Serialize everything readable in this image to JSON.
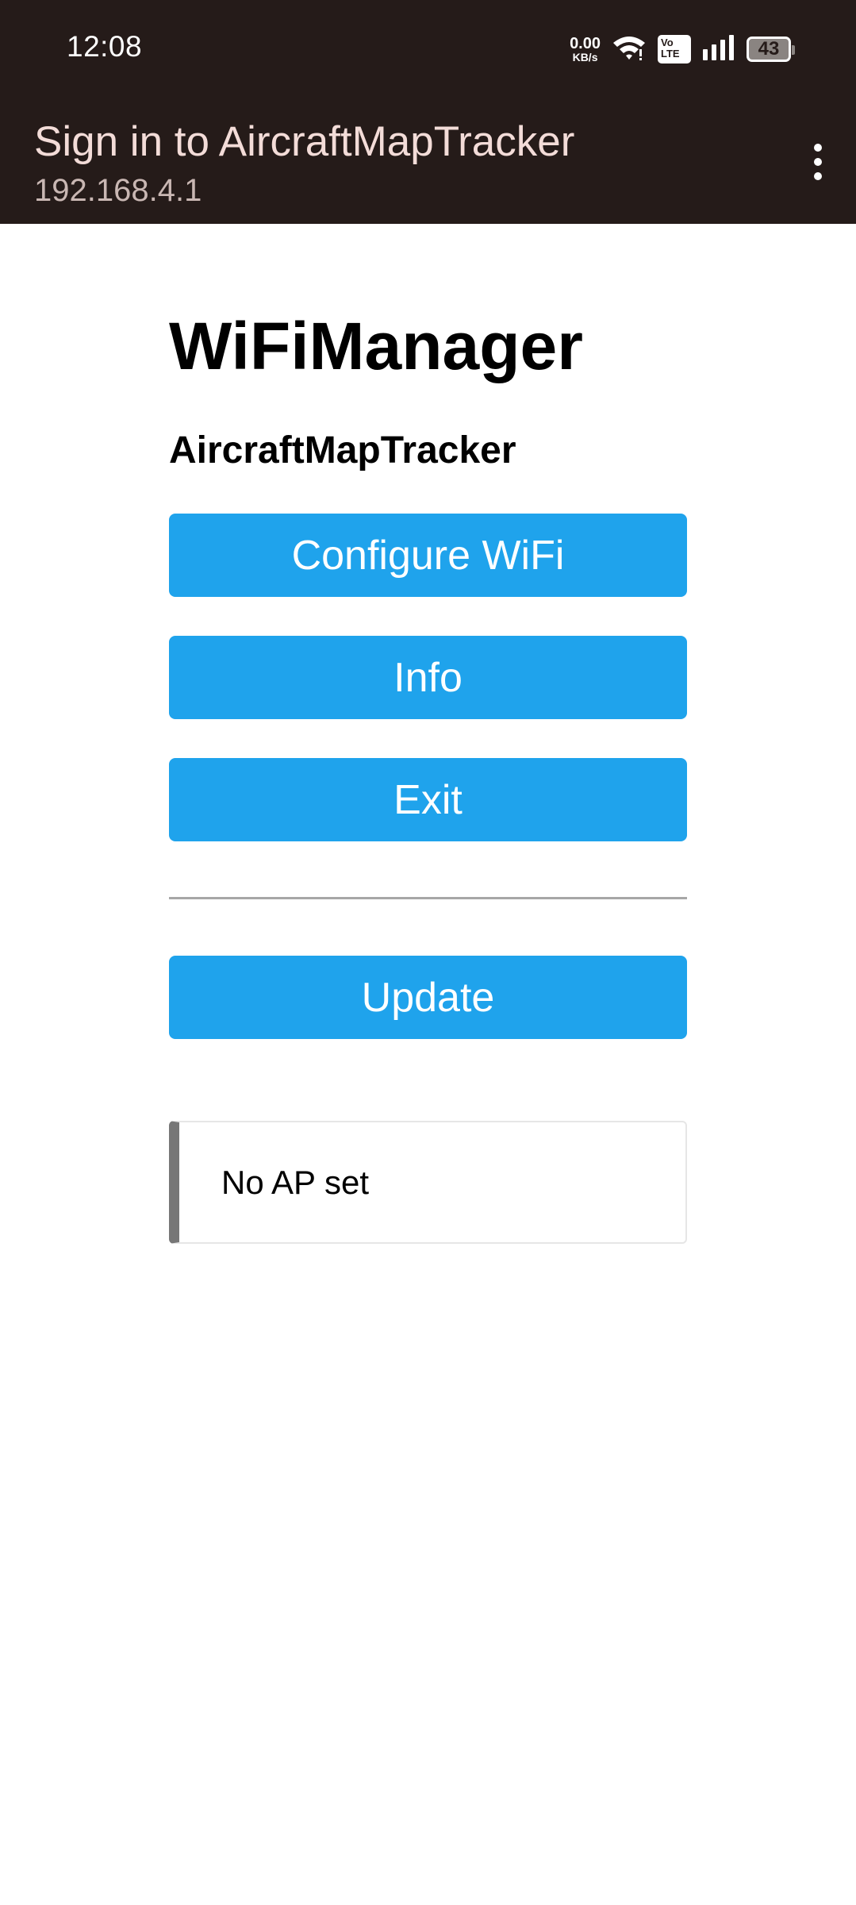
{
  "status_bar": {
    "time": "12:08",
    "net_speed_value": "0.00",
    "net_speed_unit": "KB/s",
    "volte_top": "Vo",
    "volte_bottom": "LTE",
    "battery": "43",
    "icons": [
      "wifi-icon",
      "volte-icon",
      "signal-icon",
      "battery-icon"
    ]
  },
  "app_bar": {
    "title": "Sign in to AircraftMapTracker",
    "subtitle": "192.168.4.1",
    "menu_icon": "more-vert-icon"
  },
  "page": {
    "title": "WiFiManager",
    "subtitle": "AircraftMapTracker",
    "buttons": {
      "configure": "Configure WiFi",
      "info": "Info",
      "exit": "Exit",
      "update": "Update"
    },
    "message": "No AP set"
  },
  "colors": {
    "status_bar_bg": "#251b19",
    "button_bg": "#1fa3ec",
    "button_text": "#ffffff",
    "message_accent": "#777777"
  }
}
